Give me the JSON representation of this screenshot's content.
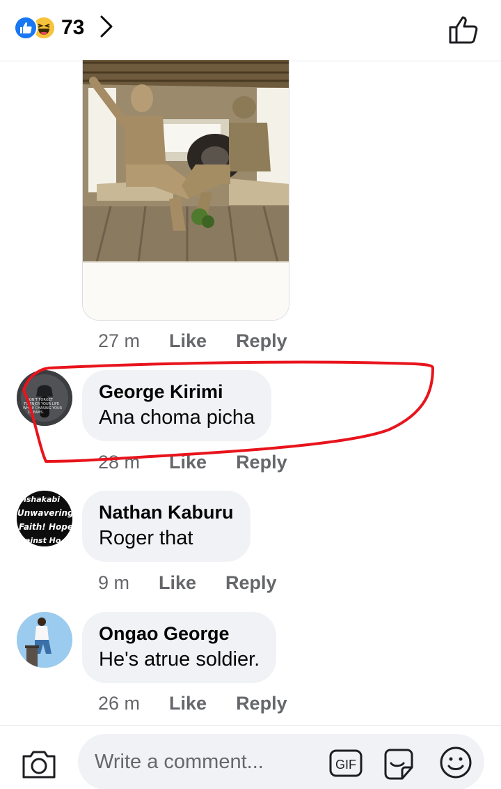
{
  "header": {
    "reaction_icons": [
      "like-icon",
      "haha-icon"
    ],
    "reaction_count": "73",
    "chevron_icon": "chevron-right-icon",
    "like_icon": "thumbs-up-outline-icon"
  },
  "comments": [
    {
      "type": "photo",
      "time": "27 m",
      "like_label": "Like",
      "reply_label": "Reply"
    },
    {
      "author": "George Kirimi",
      "text": "Ana choma picha",
      "time": "28 m",
      "like_label": "Like",
      "reply_label": "Reply",
      "avatar_text": [
        "DON'T FORGET",
        "TO ENJOY YOUR LIFE",
        "WHILE CHASING YOUR",
        "DREAMS."
      ]
    },
    {
      "author": "Nathan Kaburu",
      "text": "Roger that",
      "time": "9 m",
      "like_label": "Like",
      "reply_label": "Reply",
      "avatar_text": [
        "nshakabi",
        "Unwavering",
        "Faith! Hope",
        "ainst Ho"
      ]
    },
    {
      "author": "Ongao George",
      "text": "He's atrue soldier.",
      "time": "26 m",
      "like_label": "Like",
      "reply_label": "Reply"
    }
  ],
  "composer": {
    "placeholder": "Write a comment...",
    "camera_icon": "camera-icon",
    "gif_label": "GIF",
    "sticker_icon": "sticker-icon",
    "emoji_icon": "emoji-icon"
  },
  "colors": {
    "accent": "#1877f2",
    "haha": "#f7c33b",
    "bubble": "#f0f2f5",
    "meta_text": "#65676b",
    "annotation": "#e8141c"
  }
}
